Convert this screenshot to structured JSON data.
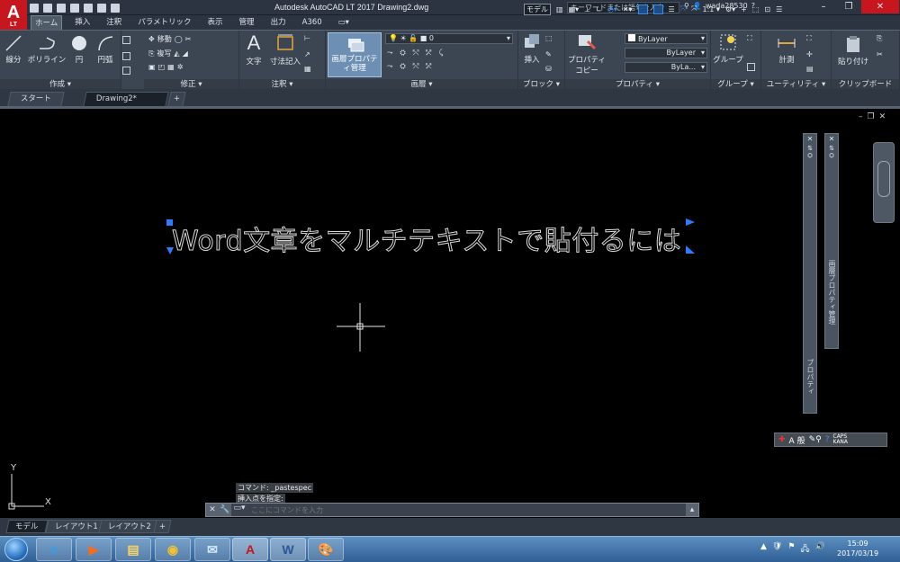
{
  "app": {
    "logo_text": "A",
    "logo_sub": "LT",
    "title": "Autodesk AutoCAD LT 2017    Drawing2.dwg",
    "search_placeholder": "キーワードまたは語句を入力",
    "user": "wada28530"
  },
  "ribbon_tabs": [
    "ホーム",
    "挿入",
    "注釈",
    "パラメトリック",
    "表示",
    "管理",
    "出力",
    "A360",
    "▭▾"
  ],
  "ribbon": {
    "draw": {
      "label": "作成 ▾",
      "line": "線分",
      "polyline": "ポリライン",
      "circle": "円",
      "arc": "円弧"
    },
    "modify": {
      "label": "修正 ▾",
      "move": "移動",
      "copy": "複写"
    },
    "annotation": {
      "label": "注釈 ▾",
      "text": "文字",
      "dimension": "寸法記入"
    },
    "layers": {
      "label": "画層 ▾",
      "props": "画層プロパティ管理",
      "current_layer": "0"
    },
    "block": {
      "label": "ブロック ▾",
      "insert": "挿入"
    },
    "properties": {
      "label": "プロパティ ▾",
      "match": "プロパティコピー",
      "color": "ByLayer",
      "linetype": "ByLayer",
      "lineweight": "ByLa..."
    },
    "groups": {
      "label": "グループ ▾",
      "group": "グループ"
    },
    "utilities": {
      "label": "ユーティリティ ▾",
      "measure": "計測"
    },
    "clipboard": {
      "label": "クリップボード",
      "paste": "貼り付け"
    }
  },
  "file_tabs": {
    "start": "スタート",
    "drawing": "Drawing2*",
    "add": "+"
  },
  "canvas": {
    "mtext": "Word文章をマルチテキストで貼付るには",
    "ucs_y": "Y",
    "ucs_x": "X"
  },
  "palettes": {
    "properties_title": "プロパティ",
    "layer_title": "画層プロパティ管理"
  },
  "command": {
    "history": [
      "コマンド: _pastespec",
      "挿入点を指定:"
    ],
    "placeholder": "ここにコマンドを入力"
  },
  "layout_tabs": [
    "モデル",
    "レイアウト1",
    "レイアウト2",
    "+"
  ],
  "status": {
    "model": "モデル",
    "scale": "1:1 ▾"
  },
  "ime": {
    "mode": "A 般",
    "caps": "CAPS\nKANA"
  },
  "taskbar": {
    "time": "15:09",
    "date": "2017/03/19"
  }
}
